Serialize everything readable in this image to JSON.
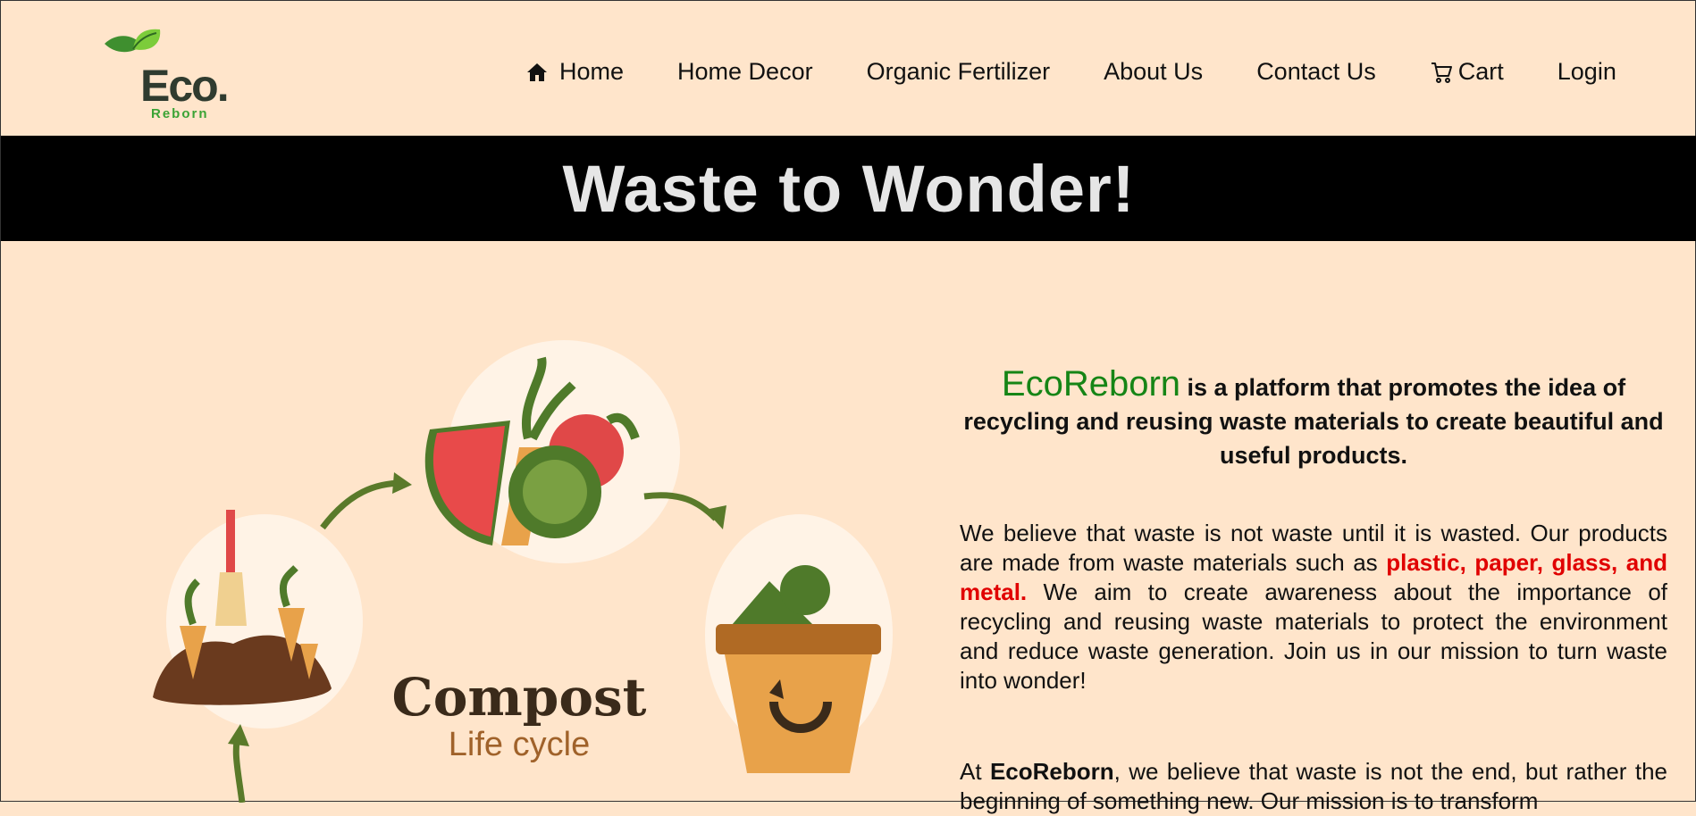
{
  "logo": {
    "text": "Eco.",
    "sub": "Reborn"
  },
  "nav": {
    "items": [
      {
        "label": "Home",
        "icon": "home-icon"
      },
      {
        "label": "Home Decor"
      },
      {
        "label": "Organic Fertilizer"
      },
      {
        "label": "About Us"
      },
      {
        "label": "Contact Us"
      },
      {
        "label": "Cart",
        "icon": "cart-icon"
      },
      {
        "label": "Login"
      }
    ]
  },
  "banner": {
    "title": "Waste to Wonder!"
  },
  "illustration": {
    "title": "Compost",
    "subtitle": "Life cycle"
  },
  "intro": {
    "brand": "EcoReborn",
    "text": " is a platform that promotes the idea of recycling and reusing waste materials to create beautiful and useful products."
  },
  "para1": {
    "before": "We believe that waste is not waste until it is wasted. Our products are made from waste materials such as ",
    "highlight": "plastic, paper, glass, and metal.",
    "after": " We aim to create awareness about the importance of recycling and reusing waste materials to protect the environment and reduce waste generation. Join us in our mission to turn waste into wonder!"
  },
  "para2": {
    "before": "At ",
    "brand": "EcoReborn",
    "after": ", we believe that waste is not the end, but rather the beginning of something new. Our mission is to transform"
  },
  "colors": {
    "background": "#ffe5cb",
    "banner": "#000000",
    "brand_green": "#168516",
    "highlight_red": "#e00000"
  }
}
